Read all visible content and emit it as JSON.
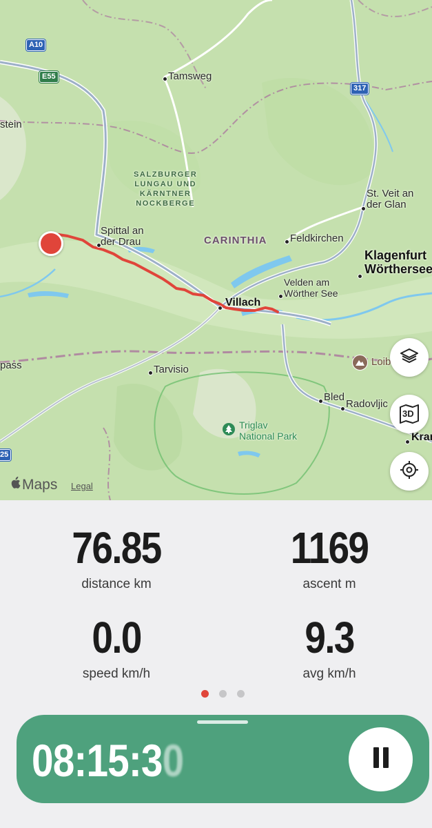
{
  "map": {
    "labels": {
      "tamsweg": "Tamsweg",
      "stein": "stein",
      "park_line1": "SALZBURGER",
      "park_line2": "LUNGAU UND",
      "park_line3": "KÄRNTNER",
      "park_line4": "NOCKBERGE",
      "spittal_1": "Spittal an",
      "spittal_2": "der Drau",
      "carinthia": "CARINTHIA",
      "feldkirchen": "Feldkirchen",
      "stveit_1": "St. Veit an",
      "stveit_2": "der Glan",
      "klagenfurt_1": "Klagenfurt",
      "klagenfurt_2": "Wörthersee",
      "velden_1": "Velden am",
      "velden_2": "Wörther See",
      "villach": "Villach",
      "pass": "pass",
      "tarvisio": "Tarvisio",
      "loibl": "Loib",
      "bled": "Bled",
      "radovljica": "Radovljic",
      "kranj": "Kran",
      "triglav_1": "Triglav",
      "triglav_2": "National Park"
    },
    "shields": {
      "a10": "A10",
      "e55": "E55",
      "r317": "317",
      "r25": "25"
    },
    "attribution": {
      "brand": "Maps",
      "legal": "Legal"
    },
    "buttons": {
      "layers_icon": "layers-icon",
      "threed_label": "3D",
      "locate_icon": "locate-icon"
    },
    "colors": {
      "route": "#e0453a",
      "land": "#c9e3b4",
      "water": "#7fc8ee",
      "road": "#9db0c8"
    }
  },
  "stats": {
    "distance": {
      "value": "76.85",
      "unit": "distance km"
    },
    "ascent": {
      "value": "1169",
      "unit": "ascent m"
    },
    "speed": {
      "value": "0.0",
      "unit": "speed km/h"
    },
    "avg": {
      "value": "9.3",
      "unit": "avg km/h"
    }
  },
  "pager": {
    "active_index": 0,
    "count": 3,
    "active_color": "#e0453a"
  },
  "timer": {
    "main": "08:15:3",
    "fading_digit": "0",
    "card_color": "#4ea17d"
  }
}
